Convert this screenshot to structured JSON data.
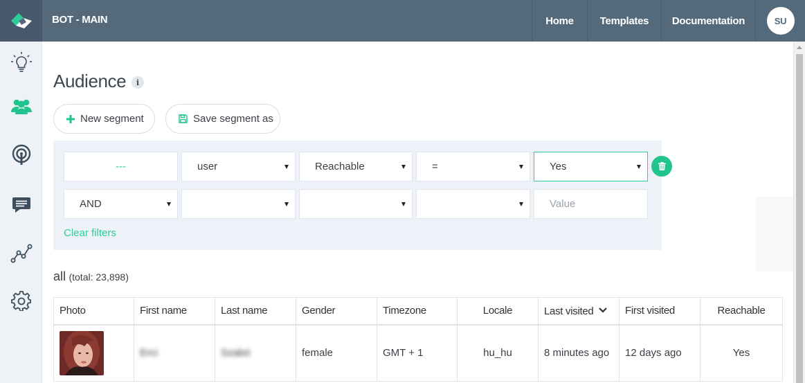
{
  "header": {
    "app_title": "BOT - MAIN",
    "nav": [
      "Home",
      "Templates",
      "Documentation"
    ],
    "user_initials": "SU",
    "bg_color": "#546a7b",
    "accent_color": "#2ecc9a"
  },
  "sidebar": {
    "items": [
      {
        "icon": "lightbulb-icon",
        "active": false
      },
      {
        "icon": "users-icon",
        "active": true
      },
      {
        "icon": "broadcast-icon",
        "active": false
      },
      {
        "icon": "chat-icon",
        "active": false
      },
      {
        "icon": "analytics-icon",
        "active": false
      },
      {
        "icon": "gear-icon",
        "active": false
      }
    ]
  },
  "page": {
    "title": "Audience",
    "info_symbol": "i",
    "new_segment": "New segment",
    "save_segment": "Save segment as"
  },
  "filters": {
    "row1": {
      "conjunction": "---",
      "field": "user",
      "attribute": "Reachable",
      "operator": "=",
      "value": "Yes"
    },
    "row2": {
      "conjunction": "AND",
      "field": "",
      "attribute": "",
      "operator": "",
      "value_placeholder": "Value"
    },
    "clear": "Clear filters"
  },
  "summary": {
    "label": "all",
    "total": "(total: 23,898)"
  },
  "table": {
    "columns": [
      "Photo",
      "First name",
      "Last name",
      "Gender",
      "Timezone",
      "Locale",
      "Last visited",
      "First visited",
      "Reachable"
    ],
    "sorted_column": "Last visited",
    "rows": [
      {
        "first_name": "Erci",
        "last_name": "Szabó",
        "gender": "female",
        "timezone": "GMT + 1",
        "locale": "hu_hu",
        "last_visited": "8 minutes ago",
        "first_visited": "12 days ago",
        "reachable": "Yes"
      }
    ]
  }
}
